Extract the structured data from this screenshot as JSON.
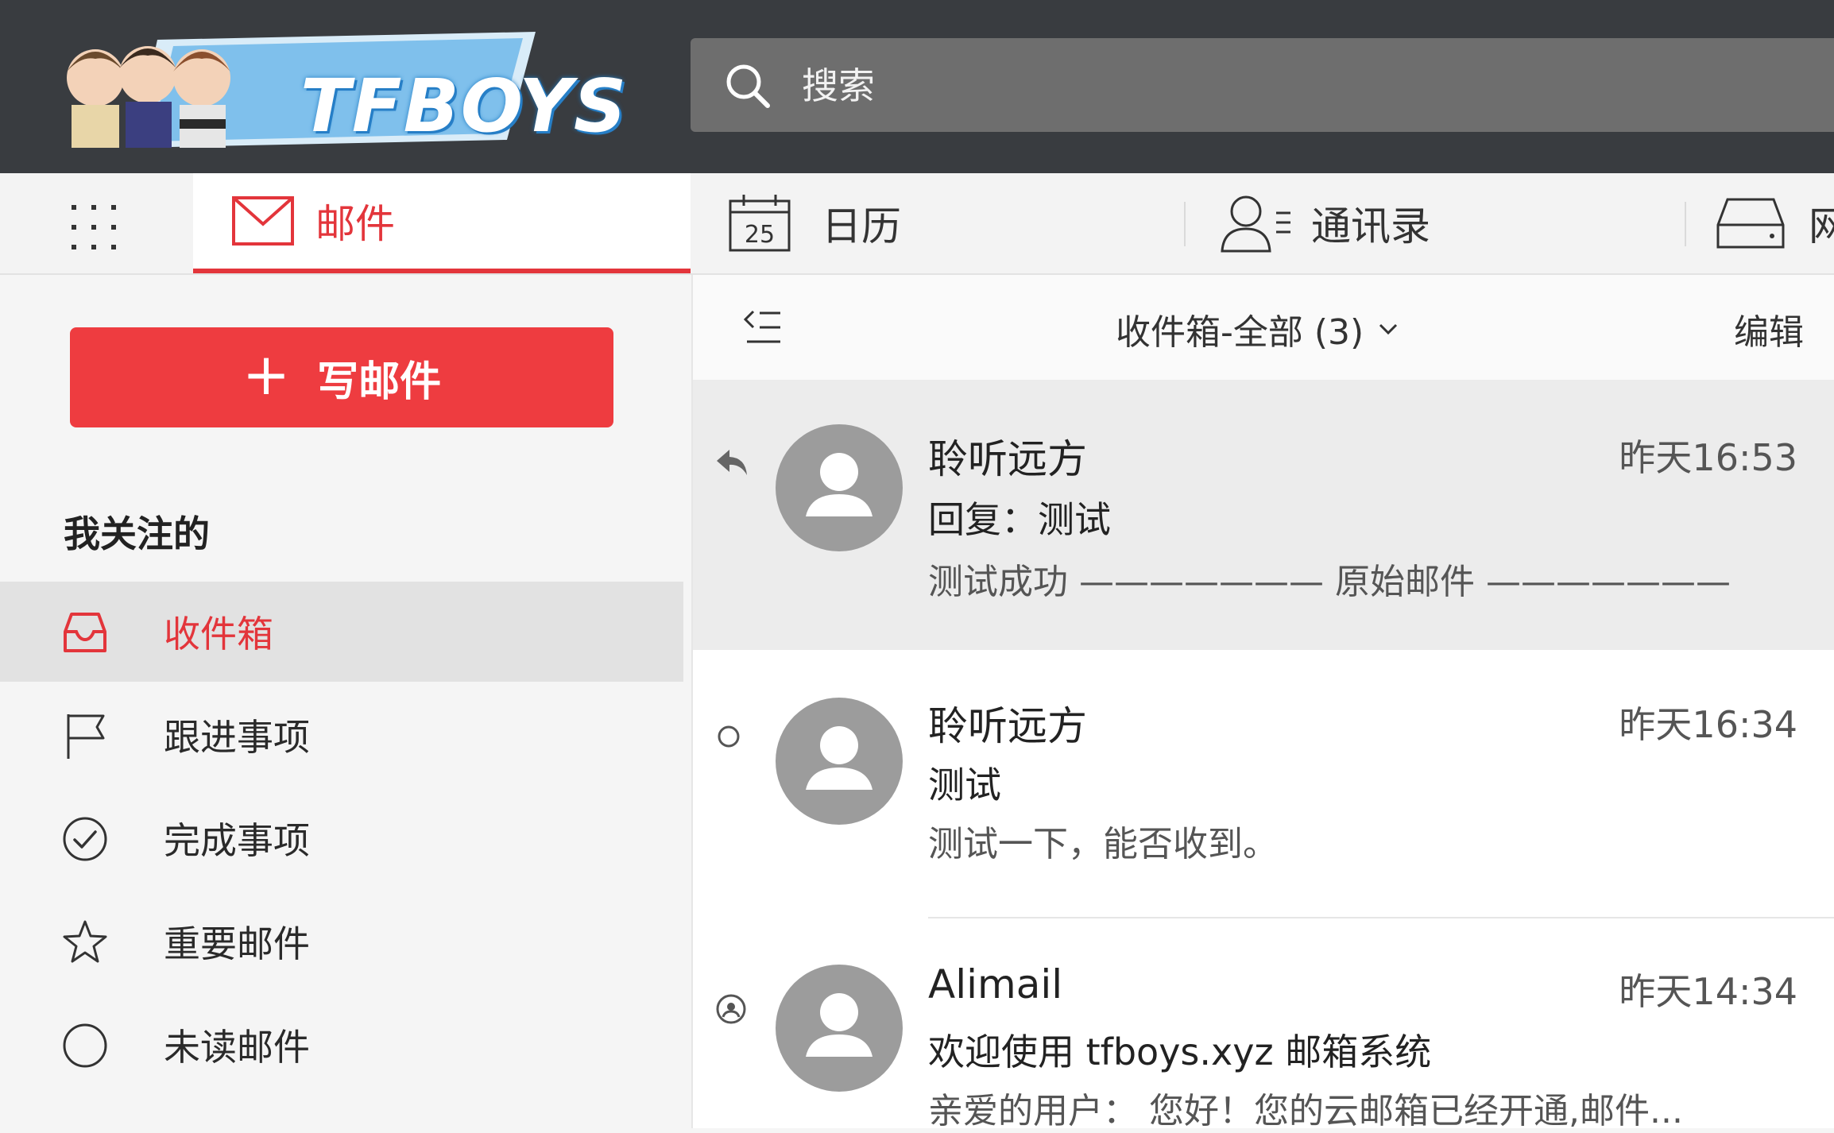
{
  "header": {
    "logo_text": "TFBOYS",
    "search_placeholder": "搜索"
  },
  "nav": {
    "mail": "邮件",
    "calendar": "日历",
    "calendar_day": "25",
    "contacts": "通讯录",
    "drive": "网"
  },
  "sidebar": {
    "compose_label": "写邮件",
    "section_title": "我关注的",
    "folders": [
      {
        "label": "收件箱",
        "icon": "inbox-icon",
        "active": true
      },
      {
        "label": "跟进事项",
        "icon": "flag-icon"
      },
      {
        "label": "完成事项",
        "icon": "check-circle-icon"
      },
      {
        "label": "重要邮件",
        "icon": "star-icon"
      },
      {
        "label": "未读邮件",
        "icon": "circle-icon"
      }
    ]
  },
  "list": {
    "folder_title": "收件箱-全部 (3)",
    "edit_label": "编辑",
    "emails": [
      {
        "sender": "聆听远方",
        "time": "昨天16:53",
        "subject": "回复：测试",
        "preview": "测试成功 ——————— 原始邮件 ———————",
        "status": "replied"
      },
      {
        "sender": "聆听远方",
        "time": "昨天16:34",
        "subject": "测试",
        "preview": "测试一下，能否收到。",
        "status": "unread"
      },
      {
        "sender": "Alimail",
        "time": "昨天14:34",
        "subject": "欢迎使用 tfboys.xyz 邮箱系统",
        "preview": "亲爱的用户：    您好！您的云邮箱已经开通,邮件...",
        "status": "system"
      }
    ]
  },
  "colors": {
    "accent": "#e3353b",
    "topbar": "#393c40",
    "search_bg": "#6e6e6e"
  }
}
